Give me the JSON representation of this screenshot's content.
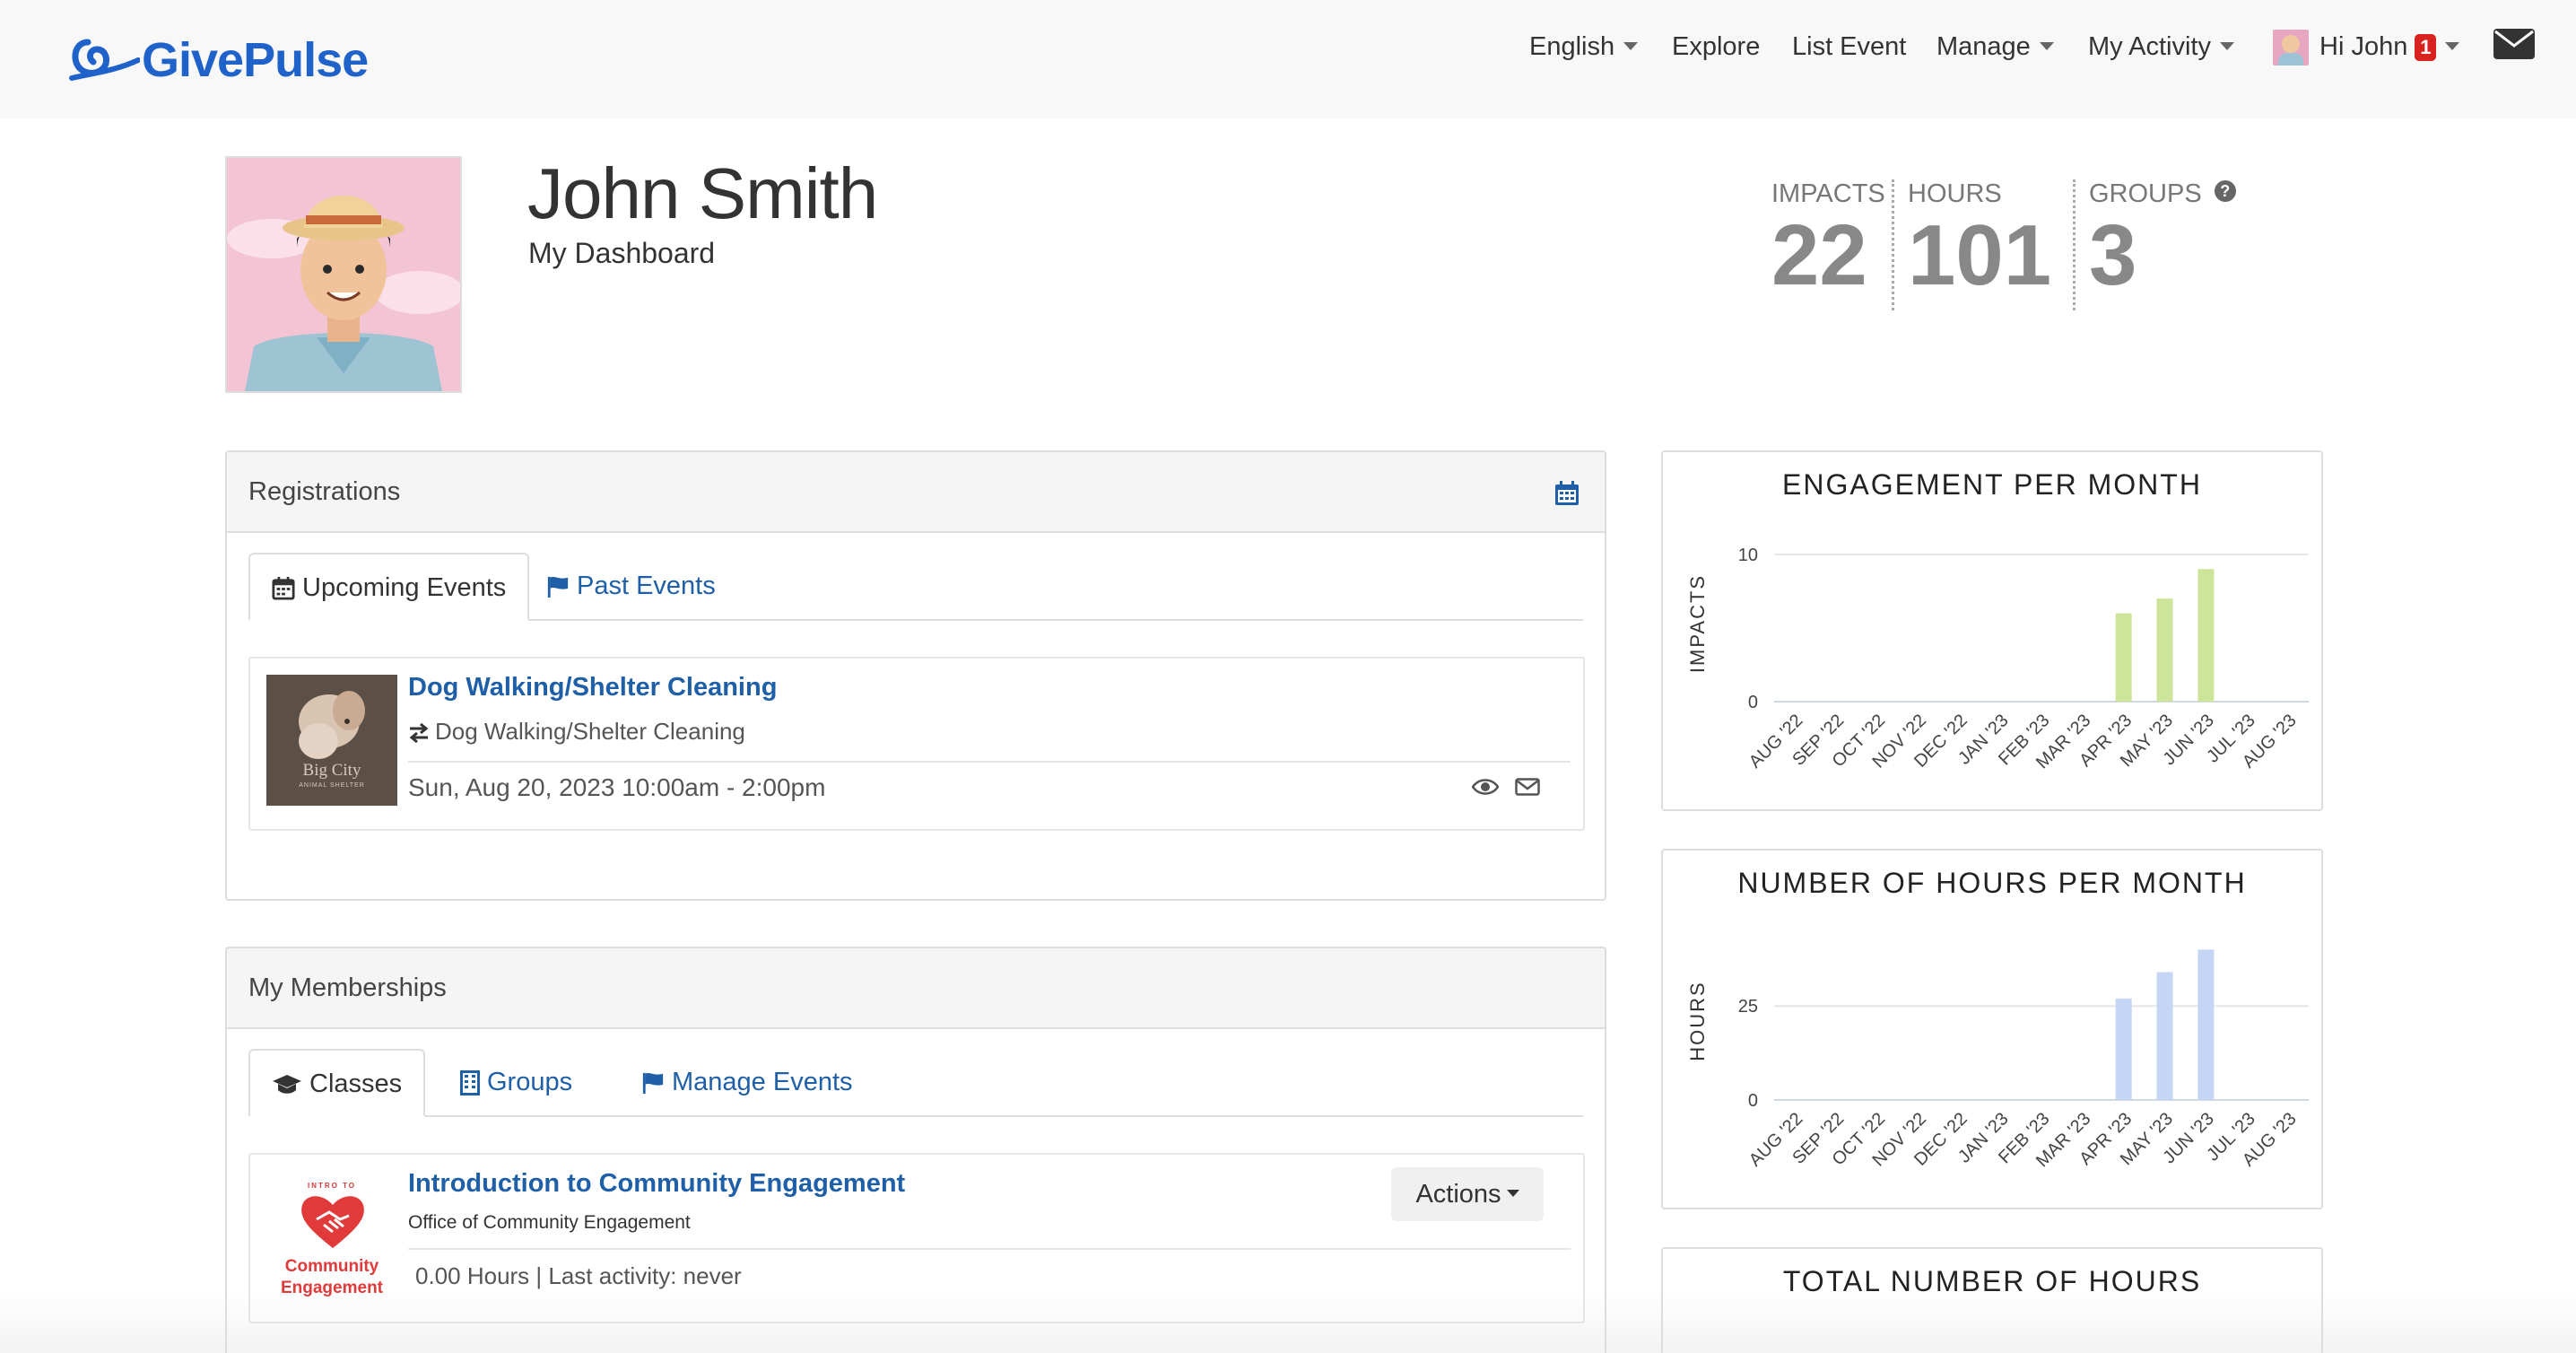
{
  "brand": {
    "name": "GivePulse",
    "color": "#1f62c9"
  },
  "nav": {
    "language": "English",
    "explore": "Explore",
    "list_event": "List Event",
    "manage": "Manage",
    "my_activity": "My Activity",
    "greeting": "Hi John",
    "notification_count": "1",
    "mail_icon": "envelope-icon"
  },
  "profile": {
    "name": "John Smith",
    "subtitle": "My Dashboard",
    "stats": [
      {
        "label": "IMPACTS",
        "value": "22"
      },
      {
        "label": "HOURS",
        "value": "101"
      },
      {
        "label": "GROUPS",
        "value": "3"
      }
    ]
  },
  "registrations": {
    "heading": "Registrations",
    "tabs": [
      "Upcoming Events",
      "Past Events"
    ],
    "active_tab": "Upcoming Events",
    "event": {
      "title": "Dog Walking/Shelter Cleaning",
      "subtitle": "Dog Walking/Shelter Cleaning",
      "datetime": "Sun, Aug 20, 2023 10:00am - 2:00pm",
      "thumb_text": "Big City",
      "thumb_subtext": "ANIMAL SHELTER"
    }
  },
  "memberships": {
    "heading": "My Memberships",
    "tabs": [
      "Classes",
      "Groups",
      "Manage Events"
    ],
    "active_tab": "Classes",
    "item": {
      "title": "Introduction to Community Engagement",
      "org": "Office of Community Engagement",
      "activity": "0.00 Hours | Last activity: never",
      "actions_label": "Actions",
      "logo_top": "INTRO TO",
      "logo_line1": "Community",
      "logo_line2": "Engagement"
    }
  },
  "chart_data": [
    {
      "type": "bar",
      "title": "ENGAGEMENT PER MONTH",
      "ylabel": "IMPACTS",
      "categories": [
        "AUG '22",
        "SEP '22",
        "OCT '22",
        "NOV '22",
        "DEC '22",
        "JAN '23",
        "FEB '23",
        "MAR '23",
        "APR '23",
        "MAY '23",
        "JUN '23",
        "JUL '23",
        "AUG '23"
      ],
      "values": [
        0,
        0,
        0,
        0,
        0,
        0,
        0,
        0,
        6,
        7,
        9,
        0,
        0
      ],
      "yticks": [
        0,
        10
      ],
      "ylim": [
        0,
        10.6
      ],
      "color": "#cde59a"
    },
    {
      "type": "bar",
      "title": "NUMBER OF HOURS PER MONTH",
      "ylabel": "HOURS",
      "categories": [
        "AUG '22",
        "SEP '22",
        "OCT '22",
        "NOV '22",
        "DEC '22",
        "JAN '23",
        "FEB '23",
        "MAR '23",
        "APR '23",
        "MAY '23",
        "JUN '23",
        "JUL '23",
        "AUG '23"
      ],
      "values": [
        0,
        0,
        0,
        0,
        0,
        0,
        0,
        0,
        27,
        34,
        40,
        0,
        0
      ],
      "yticks": [
        0,
        25
      ],
      "ylim": [
        0,
        42
      ],
      "color": "#c5d5f5"
    },
    {
      "type": "bar",
      "title": "TOTAL NUMBER OF HOURS"
    }
  ]
}
